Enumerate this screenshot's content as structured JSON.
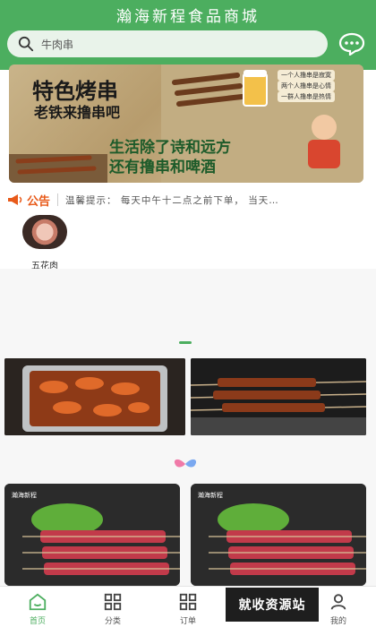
{
  "header": {
    "title": "瀚海新程食品商城"
  },
  "search": {
    "text": "牛肉串"
  },
  "banner": {
    "title_line1": "特色烤串",
    "title_line2": "老铁来撸串吧",
    "slogan_line1": "生活除了诗和远方",
    "slogan_line2": "还有撸串和啤酒",
    "notes": [
      "一个人撸串是寂寞",
      "两个人撸串是心情",
      "一群人撸串是热情"
    ]
  },
  "notice": {
    "label": "公告",
    "text": "温馨提示： 每天中午十二点之前下单， 当天…"
  },
  "categories": [
    {
      "label": "五花肉"
    }
  ],
  "products": [
    {
      "logo": "瀚海新程"
    },
    {
      "logo": "瀚海新程"
    }
  ],
  "tabbar": {
    "items": [
      {
        "label": "首页",
        "icon": "home-icon"
      },
      {
        "label": "分类",
        "icon": "grid-icon"
      },
      {
        "label": "订单",
        "icon": "grid-icon"
      },
      {
        "label": "",
        "icon": "cart-icon"
      },
      {
        "label": "我的",
        "icon": "user-icon"
      }
    ]
  },
  "watermark": {
    "text": "就收资源站"
  },
  "colors": {
    "brand": "#4cae5f",
    "notice": "#e85a1a"
  }
}
